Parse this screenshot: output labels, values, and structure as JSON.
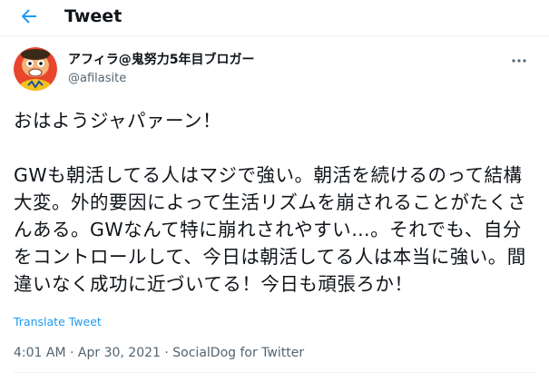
{
  "header": {
    "back_icon": "arrow-left-icon",
    "title": "Tweet",
    "accent_color": "#1d9bf0"
  },
  "tweet": {
    "author": {
      "display_name": "アフィラ@鬼努力5年目ブロガー",
      "handle": "@afilasite",
      "avatar_icon": "cartoon-avatar"
    },
    "more_icon": "more-dots-icon",
    "text": "おはようジャパァーン！\n\nGWも朝活してる人はマジで強い。朝活を続けるのって結構大変。外的要因によって生活リズムを崩されることがたくさんある。GWなんて特に崩れされやすい…。それでも、自分をコントロールして、今日は朝活してる人は本当に強い。間違いなく成功に近づいてる！今日も頑張ろか！",
    "translate_label": "Translate Tweet",
    "time": "4:01 AM",
    "separator": "·",
    "date": "Apr 30, 2021",
    "source": "SocialDog for Twitter"
  }
}
